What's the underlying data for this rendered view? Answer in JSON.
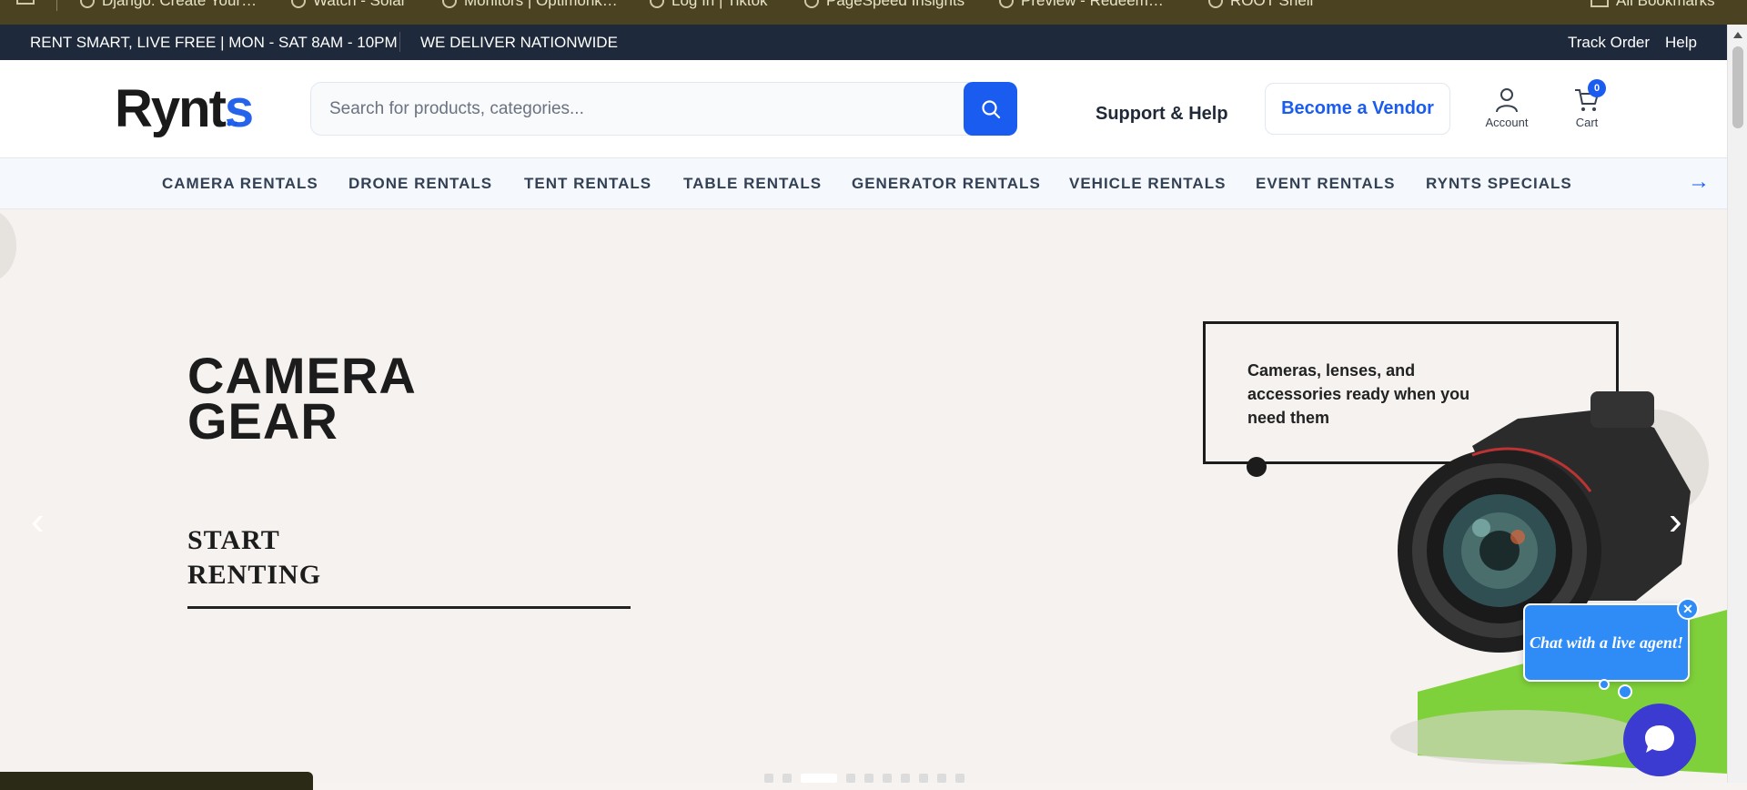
{
  "browser_bookmarks": [
    "Django: Create Your…",
    "Watch - Solar",
    "Monitors | Optimonk…",
    "Log In | Tiktok",
    "PageSpeed Insights",
    "Preview - Redeem…",
    "ROOT Shell",
    "All Bookmarks"
  ],
  "topbar": {
    "left_text": "RENT SMART, LIVE FREE | MON - SAT 8AM - 10PM",
    "left_text_2": "WE DELIVER NATIONWIDE",
    "track_order": "Track Order",
    "help": "Help"
  },
  "header": {
    "logo_text": "Rynts",
    "search_placeholder": "Search for products, categories...",
    "support": "Support & Help",
    "vendor": "Become a Vendor",
    "account": "Account",
    "cart": "Cart",
    "cart_count": "0"
  },
  "categories": [
    "CAMERA RENTALS",
    "DRONE RENTALS",
    "TENT RENTALS",
    "TABLE RENTALS",
    "GENERATOR RENTALS",
    "VEHICLE RENTALS",
    "EVENT RENTALS",
    "RYNTS SPECIALS"
  ],
  "nav_next": "→",
  "hero": {
    "title_line1": "CAMERA",
    "title_line2": "GEAR",
    "cta_line1": "START",
    "cta_line2": "RENTING",
    "box_text": "Cameras, lenses, and accessories ready when you need them",
    "slides_total": 10,
    "active_slide": 3
  },
  "chat": {
    "bubble_text": "Chat with a live agent!",
    "close": "✕"
  },
  "colors": {
    "brand_blue": "#1a5cf0",
    "topbar": "#1e293b",
    "hero_bg": "#f5f2ef",
    "chat_blue": "#2f8cf6",
    "chat_launcher": "#3b3bd1"
  }
}
